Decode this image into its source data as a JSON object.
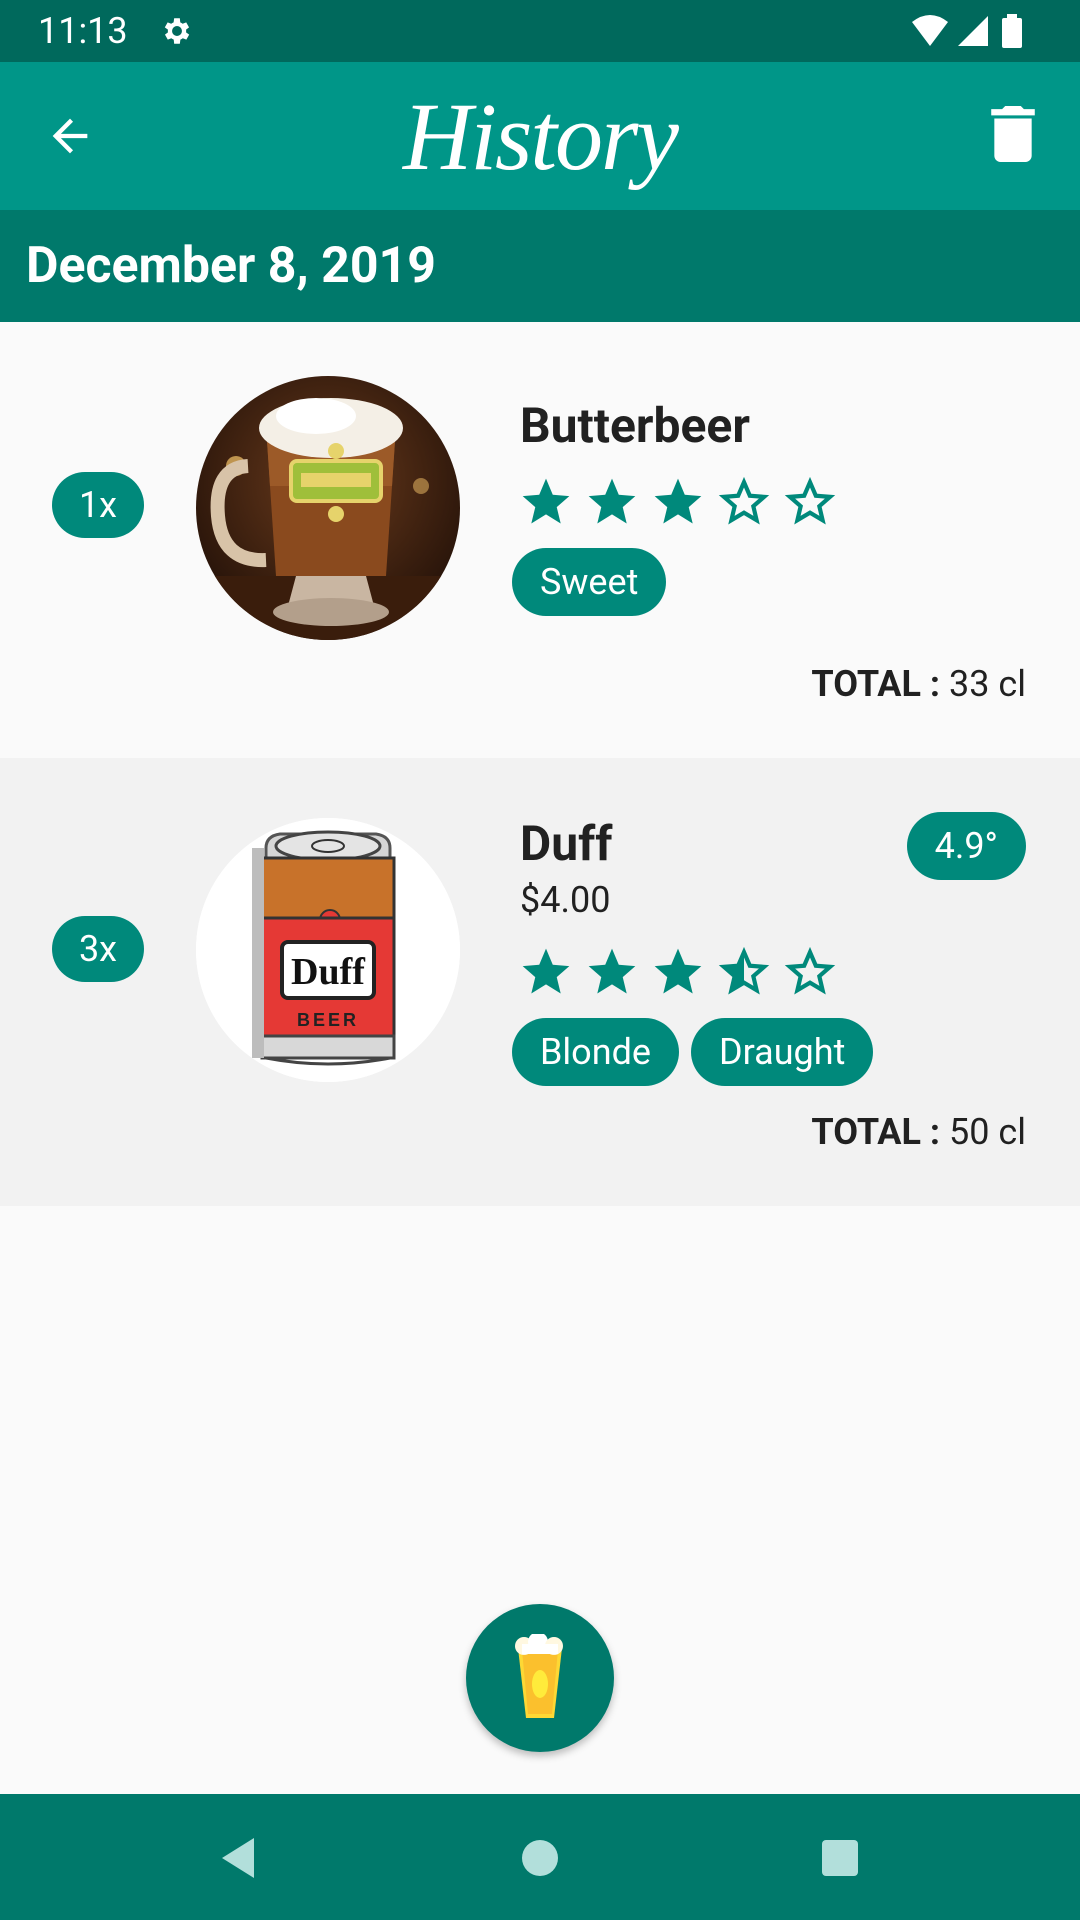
{
  "status_bar": {
    "time": "11:13",
    "icons": [
      "gear-icon",
      "wifi-icon",
      "signal-icon",
      "battery-icon"
    ]
  },
  "app_bar": {
    "title": "History",
    "back_icon": "arrow-left-icon",
    "delete_icon": "trash-icon",
    "color": "#009688"
  },
  "section": {
    "date": "December 8, 2019",
    "color": "#00796b"
  },
  "entries": [
    {
      "quantity": "1x",
      "name": "Butterbeer",
      "rating": 3,
      "rating_max": 5,
      "tags": [
        "Sweet"
      ],
      "total_label": "TOTAL :",
      "total_value": "33 cl",
      "image": "butterbeer-mug"
    },
    {
      "quantity": "3x",
      "name": "Duff",
      "price": "$4.00",
      "abv": "4.9°",
      "rating": 3.5,
      "rating_max": 5,
      "tags": [
        "Blonde",
        "Draught"
      ],
      "total_label": "TOTAL :",
      "total_value": "50 cl",
      "image": "duff-beer-can"
    }
  ],
  "fab": {
    "icon": "beer-glass-icon"
  },
  "nav_bar": {
    "icons": [
      "back-triangle-icon",
      "home-circle-icon",
      "recents-square-icon"
    ]
  },
  "accent": "#00897b"
}
